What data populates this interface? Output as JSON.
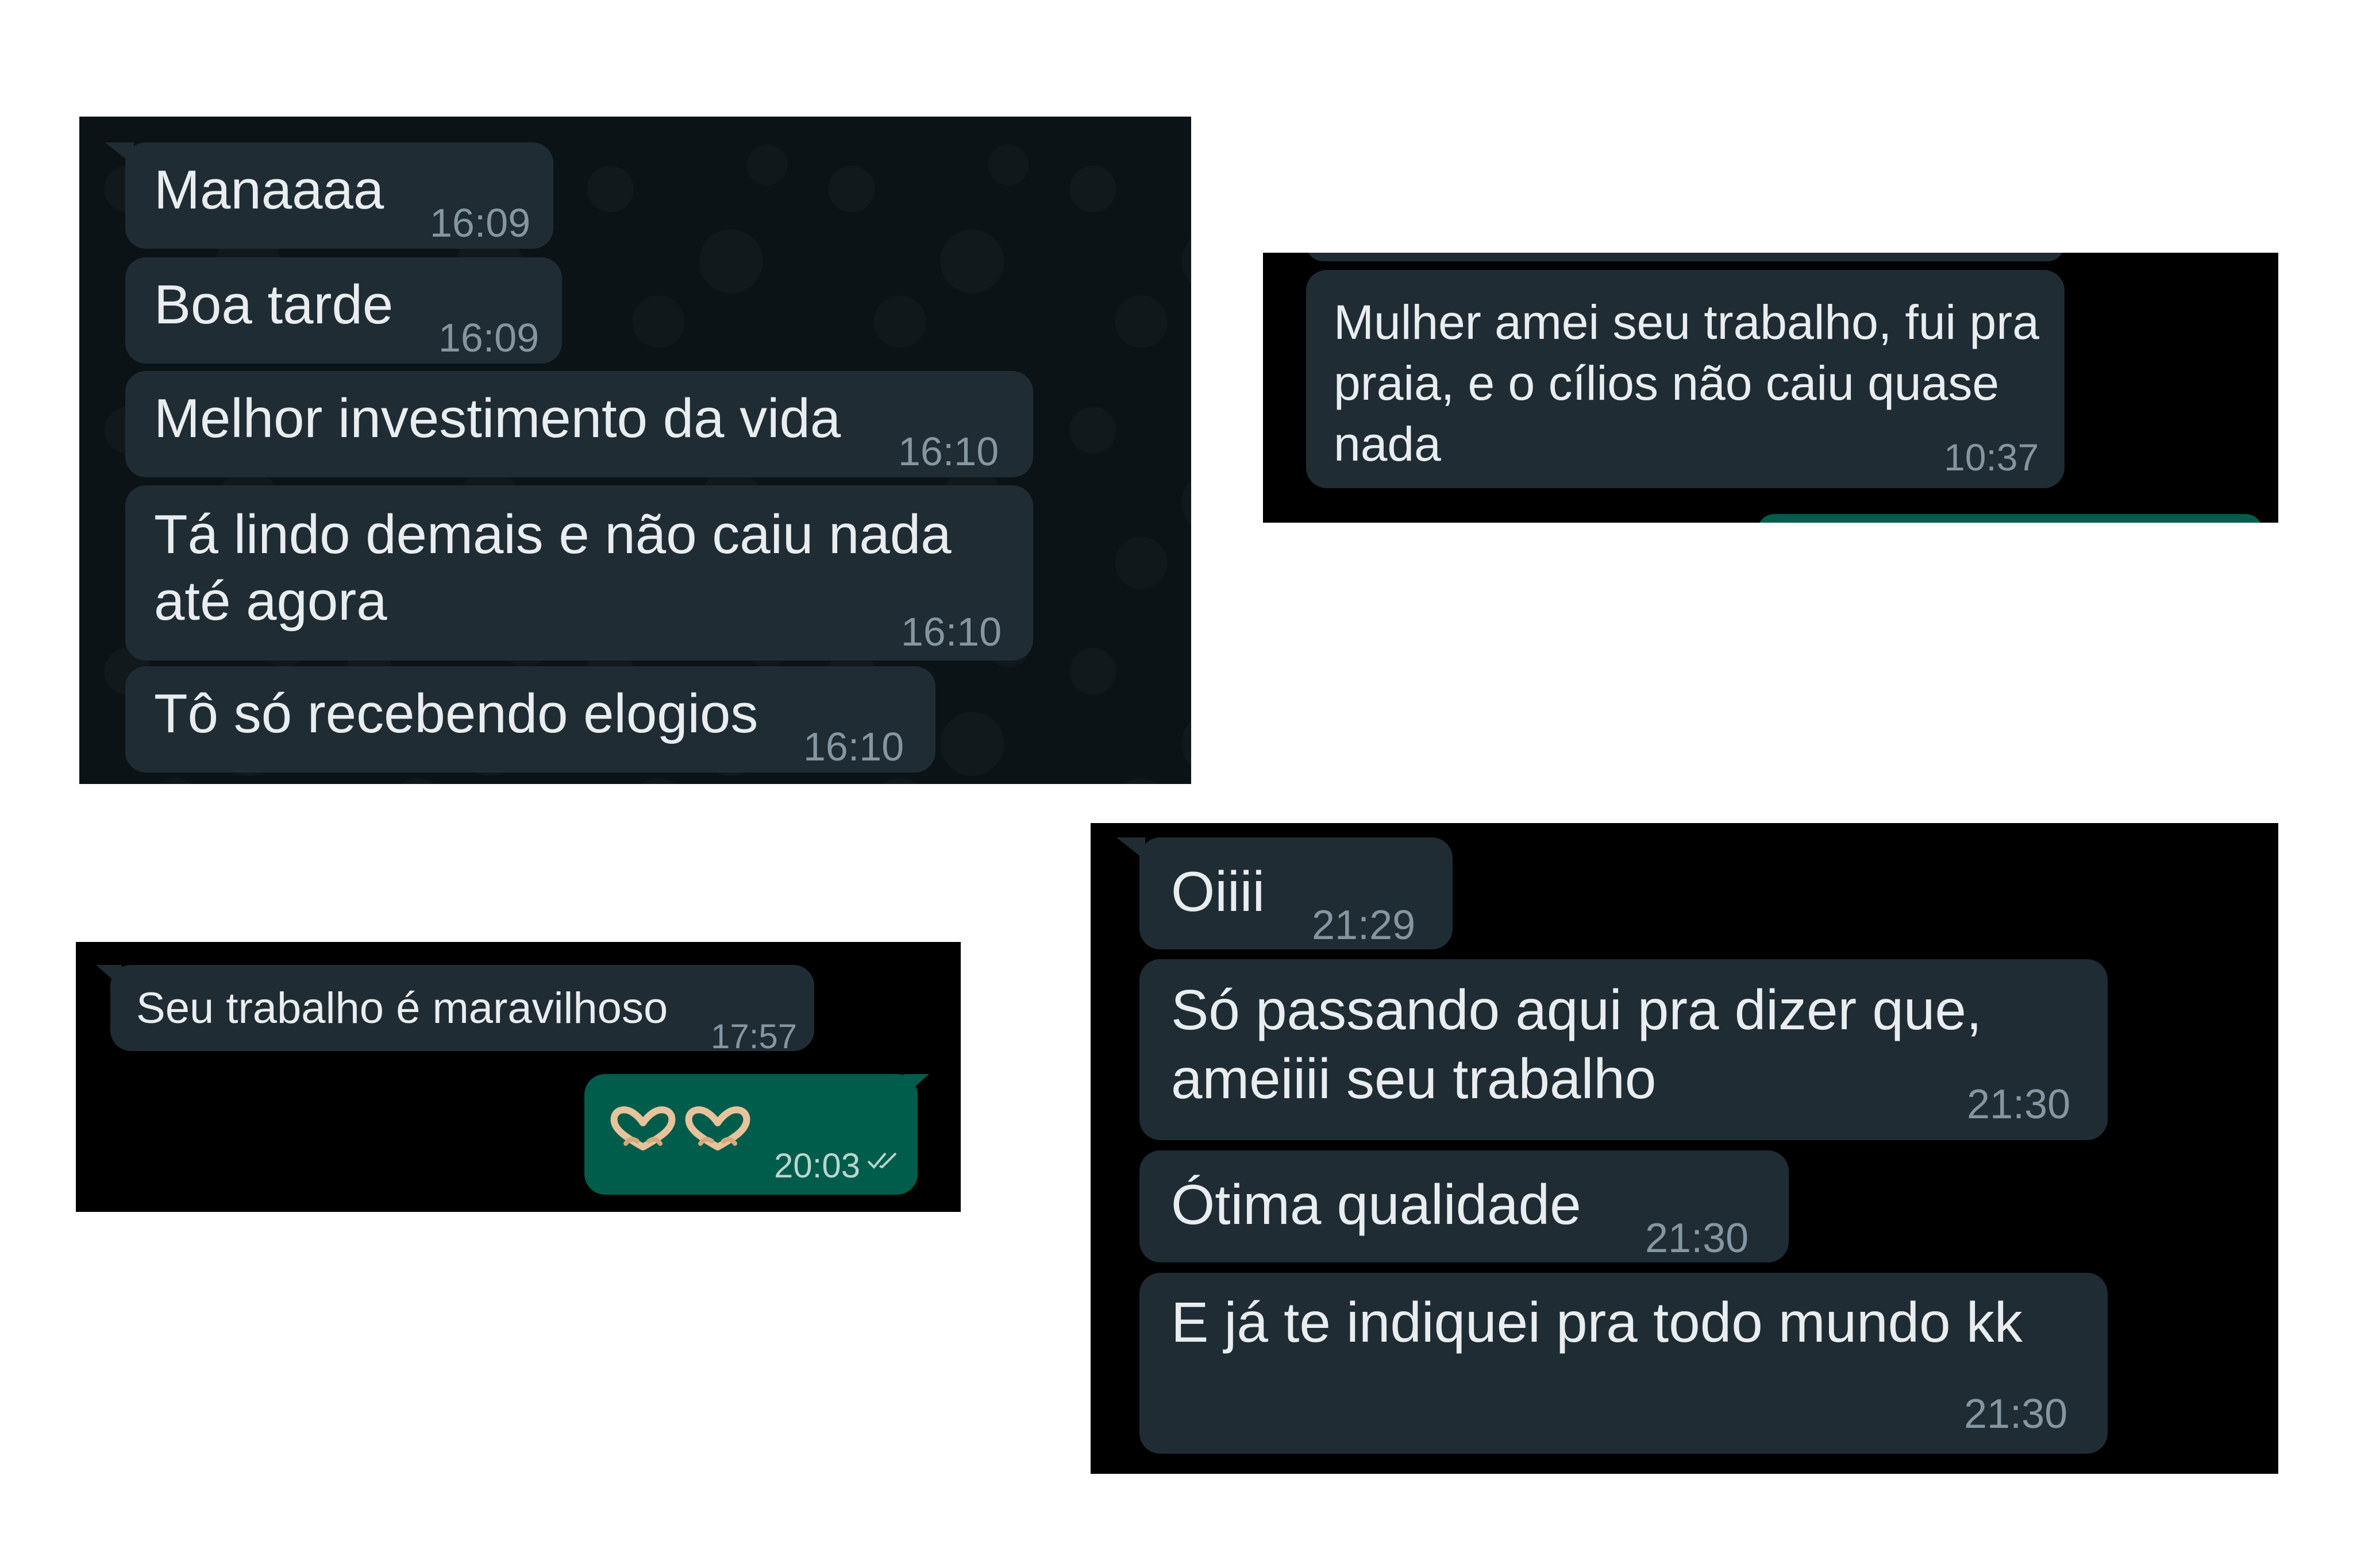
{
  "colors": {
    "page_background": "#ffffff",
    "chat_background_pattern": "#0c1317",
    "chat_background_black": "#000000",
    "incoming_bubble": "#1f2c33",
    "outgoing_bubble": "#005c4b",
    "message_text": "#e9edef",
    "timestamp": "#8696a0"
  },
  "screenshot_1": {
    "messages": [
      {
        "text": "Manaaaa",
        "time": "16:09"
      },
      {
        "text": "Boa tarde",
        "time": "16:09"
      },
      {
        "text": "Melhor investimento da vida",
        "time": "16:10"
      },
      {
        "text": "Tá lindo demais e não caiu nada\naté agora",
        "time": "16:10"
      },
      {
        "text": "Tô só recebendo elogios",
        "time": "16:10"
      }
    ]
  },
  "screenshot_2": {
    "messages": [
      {
        "text": "Mulher amei seu trabalho, fui pra\npraia, e o cílios não caiu quase\nnada",
        "time": "10:37"
      }
    ]
  },
  "screenshot_3": {
    "messages": [
      {
        "text": "Seu trabalho é maravilhoso",
        "time": "17:57",
        "direction": "incoming"
      },
      {
        "icons": [
          "heart-hands-icon",
          "heart-hands-icon"
        ],
        "time": "20:03",
        "direction": "outgoing",
        "status_icon": "double-check-icon"
      }
    ]
  },
  "screenshot_4": {
    "messages": [
      {
        "text": "Oiiii",
        "time": "21:29"
      },
      {
        "text": "Só passando aqui pra dizer que,\nameiiii seu trabalho",
        "time": "21:30"
      },
      {
        "text": "Ótima qualidade",
        "time": "21:30"
      },
      {
        "text": "E já te indiquei pra todo mundo kk",
        "time": "21:30"
      }
    ]
  }
}
